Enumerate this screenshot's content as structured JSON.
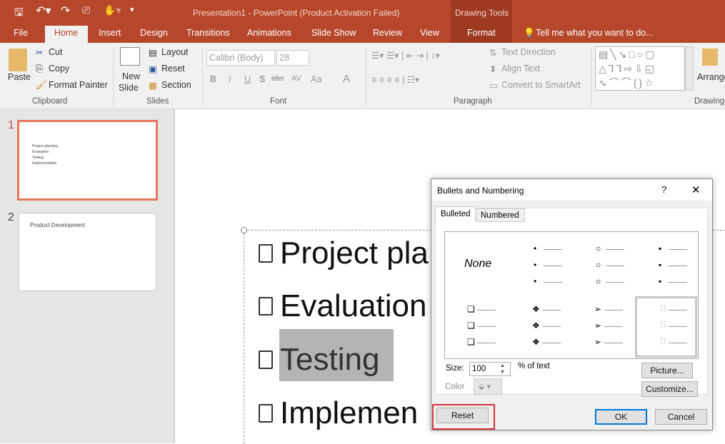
{
  "title": "Presentation1 - PowerPoint (Product Activation Failed)",
  "context_tab_group": "Drawing Tools",
  "tabs": [
    "File",
    "Home",
    "Insert",
    "Design",
    "Transitions",
    "Animations",
    "Slide Show",
    "Review",
    "View",
    "Format"
  ],
  "active_tab": "Home",
  "tell_me": "Tell me what you want to do...",
  "ribbon": {
    "clipboard": {
      "paste": "Paste",
      "cut": "Cut",
      "copy": "Copy",
      "format_painter": "Format Painter",
      "label": "Clipboard"
    },
    "slides": {
      "new_slide": "New",
      "new_slide2": "Slide",
      "layout": "Layout",
      "reset": "Reset",
      "section": "Section",
      "label": "Slides"
    },
    "font": {
      "font_name": "Calibri (Body)",
      "font_size": "28",
      "label": "Font",
      "bold": "B",
      "italic": "I",
      "underline": "U",
      "shadow": "S",
      "strike": "abc",
      "spacing": "AV",
      "case": "Aa",
      "color": "A"
    },
    "paragraph": {
      "text_direction": "Text Direction",
      "align_text": "Align Text",
      "convert_smartart": "Convert to SmartArt",
      "label": "Paragraph"
    },
    "drawing": {
      "arrange": "Arrange",
      "label": "Drawing"
    }
  },
  "slides": [
    {
      "number": "1",
      "lines": [
        "Project planning",
        "Evaluation",
        "Testing",
        "Implementation"
      ]
    },
    {
      "number": "2",
      "title": "Product Development"
    }
  ],
  "slide_text": [
    "Project pla",
    "Evaluation",
    "Testing",
    "Implemen"
  ],
  "dialog": {
    "title": "Bullets and Numbering",
    "help": "?",
    "close": "✕",
    "tabs": [
      "Bulleted",
      "Numbered"
    ],
    "none": "None",
    "size_label": "Size:",
    "size_value": "100",
    "percent_label": "% of text",
    "color_label": "Color",
    "picture": "Picture...",
    "customize": "Customize...",
    "reset": "Reset",
    "ok": "OK",
    "cancel": "Cancel",
    "bullet_glyphs": [
      "•",
      "○",
      "▪",
      "❑",
      "❖",
      "➢",
      "📋"
    ]
  },
  "colors": {
    "accent": "#b7472a",
    "highlight": "#d13438",
    "ok_border": "#0078d7"
  }
}
